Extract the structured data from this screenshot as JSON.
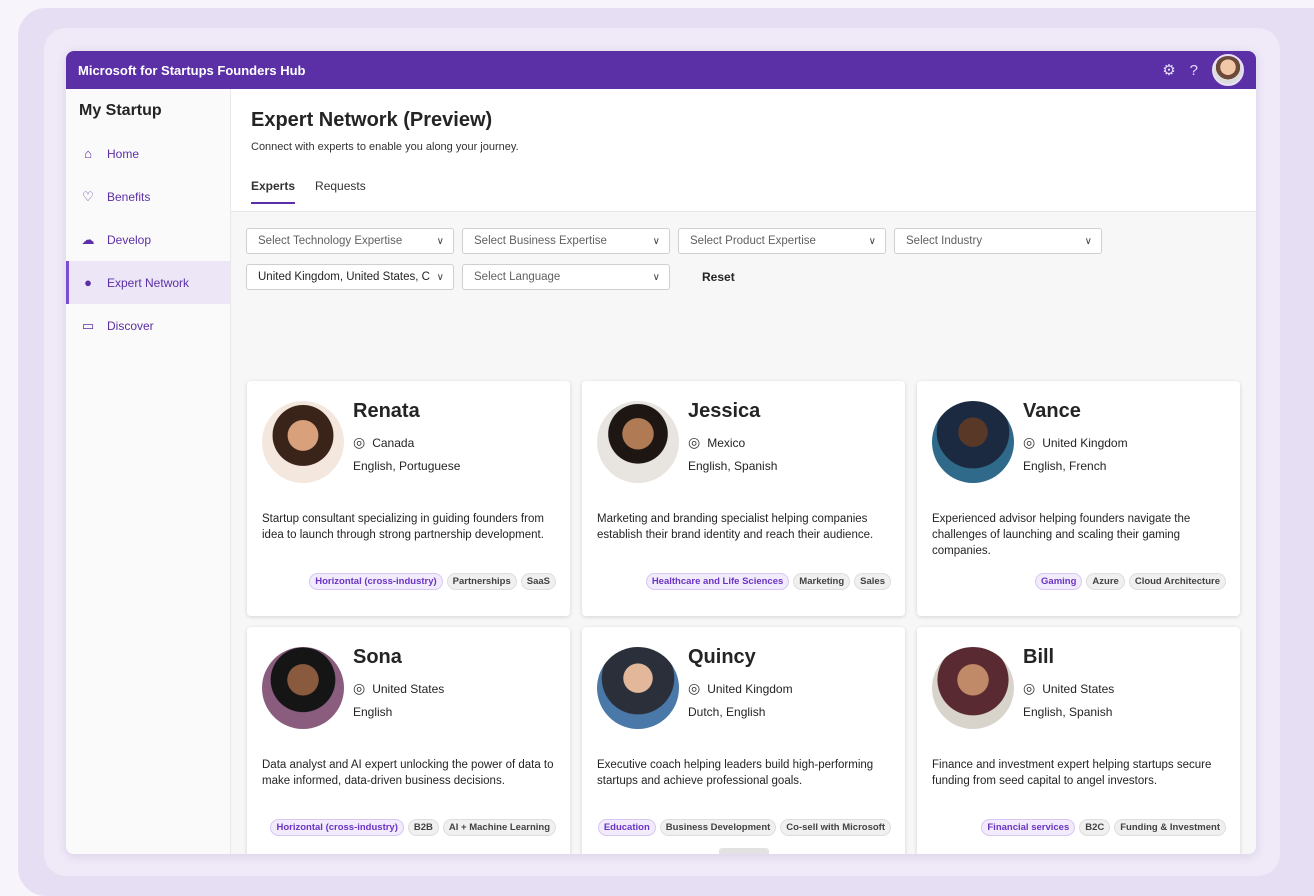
{
  "app": {
    "title": "Microsoft for Startups Founders Hub",
    "settings_icon": "gear-icon",
    "help_icon": "?"
  },
  "sidebar": {
    "title": "My Startup",
    "items": [
      {
        "label": "Home",
        "icon": "⌂"
      },
      {
        "label": "Benefits",
        "icon": "♡"
      },
      {
        "label": "Develop",
        "icon": "☁"
      },
      {
        "label": "Expert Network",
        "icon": "●"
      },
      {
        "label": "Discover",
        "icon": "▭"
      }
    ]
  },
  "page": {
    "title": "Expert Network (Preview)",
    "subtitle": "Connect with experts to enable you along your journey.",
    "tabs": [
      "Experts",
      "Requests"
    ]
  },
  "filters": {
    "technology": "Select Technology Expertise",
    "business": "Select Business Expertise",
    "product": "Select Product Expertise",
    "industry": "Select Industry",
    "location": "United Kingdom, United States, C",
    "language": "Select Language",
    "reset": "Reset"
  },
  "experts": [
    {
      "name": "Renata",
      "location": "Canada",
      "languages": "English, Portuguese",
      "description": "Startup consultant specializing in guiding founders from idea to launch through strong partnership development.",
      "tags": [
        "Horizontal (cross-industry)",
        "Partnerships",
        "SaaS"
      ]
    },
    {
      "name": "Jessica",
      "location": "Mexico",
      "languages": "English, Spanish",
      "description": "Marketing and branding specialist helping companies establish their brand identity and reach their audience.",
      "tags": [
        "Healthcare and Life Sciences",
        "Marketing",
        "Sales"
      ]
    },
    {
      "name": "Vance",
      "location": "United Kingdom",
      "languages": "English, French",
      "description": "Experienced advisor helping founders navigate the challenges of launching and scaling their gaming companies.",
      "tags": [
        "Gaming",
        "Azure",
        "Cloud Architecture"
      ]
    },
    {
      "name": "Sona",
      "location": "United States",
      "languages": "English",
      "description": "Data analyst and AI expert unlocking the power of data to make informed, data-driven business decisions.",
      "tags": [
        "Horizontal (cross-industry)",
        "B2B",
        "AI + Machine Learning"
      ]
    },
    {
      "name": "Quincy",
      "location": "United Kingdom",
      "languages": "Dutch, English",
      "description": "Executive coach helping leaders build high-performing startups and achieve professional goals.",
      "tags": [
        "Education",
        "Business Development",
        "Co-sell with Microsoft"
      ]
    },
    {
      "name": "Bill",
      "location": "United States",
      "languages": "English, Spanish",
      "description": "Finance and investment expert helping startups secure funding from seed capital to angel investors.",
      "tags": [
        "Financial services",
        "B2C",
        "Funding & Investment"
      ]
    }
  ]
}
